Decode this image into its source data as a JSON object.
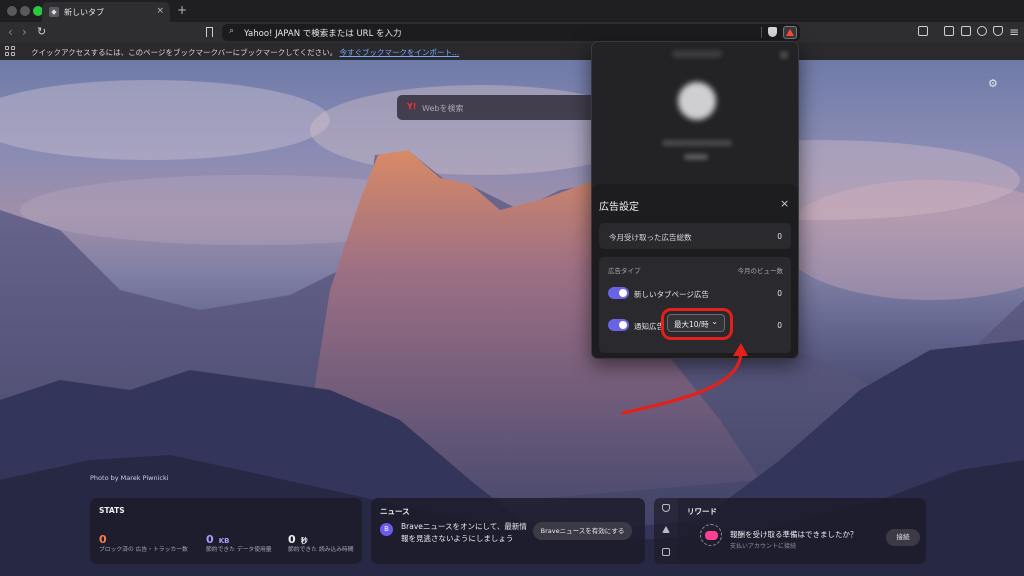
{
  "window": {
    "tab": {
      "title": "新しいタブ",
      "close": "×"
    },
    "new_tab": "+"
  },
  "toolbar": {
    "back": "‹",
    "forward": "›",
    "reload": "↻",
    "url_search_icon": "🔍",
    "url_placeholder": "Yahoo! JAPAN で検索または URL を入力"
  },
  "bookmark_bar": {
    "text": "クイックアクセスするには、このページをブックマークバーにブックマークしてください。",
    "link": "今すぐブックマークをインポート..."
  },
  "background": {
    "photo_credit": "Photo by Marek Piwnicki",
    "gear": "⚙"
  },
  "search": {
    "logo": "Y!",
    "placeholder": "Webを検索"
  },
  "ad_settings": {
    "title": "広告設定",
    "close": "×",
    "total_label": "今月受け取った広告総数",
    "total_value": "0",
    "col_type": "広告タイプ",
    "col_views": "今月のビュー数",
    "types": [
      {
        "label": "新しいタブページ広告",
        "count": "0",
        "enabled": true
      },
      {
        "label": "通知広告",
        "count": "0",
        "enabled": true
      }
    ],
    "frequency": "最大10/時",
    "frequency_chevron": "⌄"
  },
  "stats": {
    "title": "STATS",
    "items": [
      {
        "value": "0",
        "unit": "",
        "label": "ブロック済の 広告・トラッカー数",
        "color": "#ff7a4d"
      },
      {
        "value": "0",
        "unit": "KB",
        "label": "節約できた データ使用量",
        "color": "#a79cff"
      },
      {
        "value": "0",
        "unit": "秒",
        "label": "節約できた 読み込み時間",
        "color": "#f0f0f2"
      }
    ]
  },
  "news": {
    "title": "ニュース",
    "icon": "B",
    "text": "Braveニュースをオンにして、最新情報を見逃さないようにしましょう",
    "button": "Braveニュースを有効にする"
  },
  "rewards": {
    "title": "リワード",
    "heading": "報酬を受け取る準備はできましたか？",
    "sub": "支払いアカウントに接続",
    "button": "接続"
  }
}
